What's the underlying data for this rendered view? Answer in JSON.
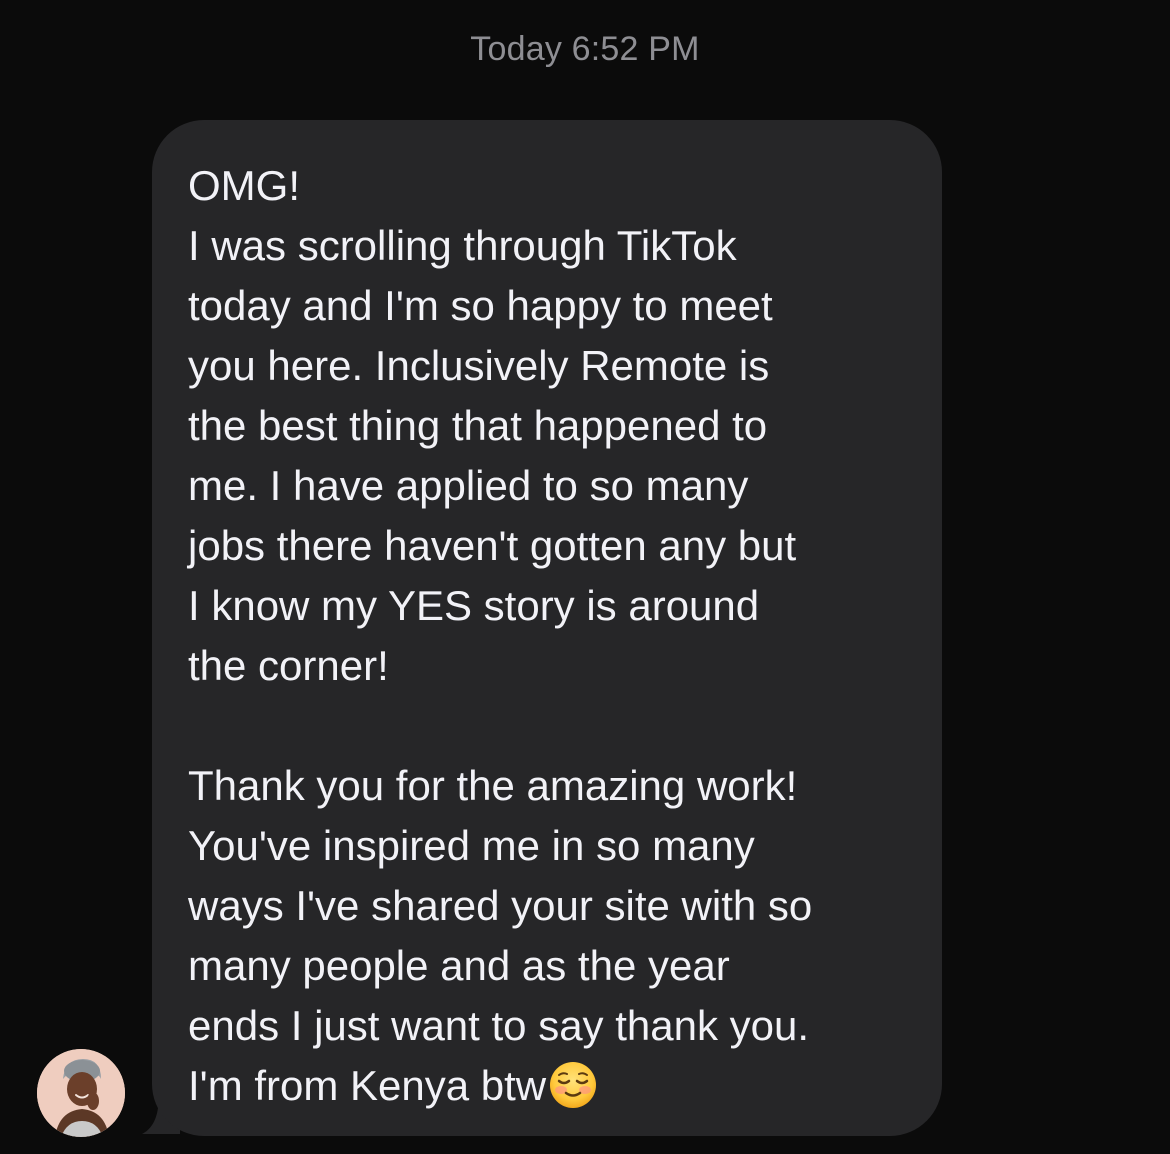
{
  "conversation": {
    "timestamp": "Today 6:52 PM"
  },
  "message": {
    "lines": [
      "OMG!",
      "I was scrolling through TikTok",
      "today and I'm so happy to meet",
      "you here. Inclusively Remote is",
      "the best thing that happened to",
      "me. I have applied to so many",
      "jobs there haven't gotten any but",
      "I know my YES story is around",
      "the corner!",
      "",
      "Thank you for the amazing work!",
      "You've inspired me in so many",
      "ways I've shared your site with so",
      "many people and as the year",
      "ends I just want to say thank you."
    ],
    "last_line": "I'm from Kenya btw",
    "emoji": "smiling-face-emoji"
  },
  "sender": {
    "avatar": "sender-avatar-photo"
  },
  "colors": {
    "background": "#0b0b0b",
    "bubble": "#262628",
    "text": "#f2f2f7",
    "timestamp": "#8e8e93"
  }
}
